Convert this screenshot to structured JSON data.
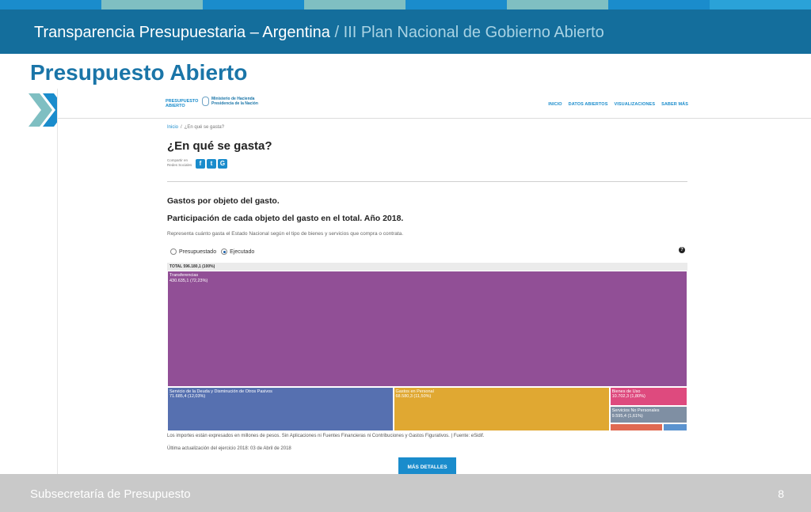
{
  "colors": {
    "stripe": [
      "#1a8ccc",
      "#7fbfc2",
      "#1a8ccc",
      "#7fbfc2",
      "#1a8ccc",
      "#7fbfc2",
      "#1a8ccc",
      "#2aa2d8"
    ],
    "topbar": "#146e9c",
    "accent": "#1a75a8"
  },
  "slide": {
    "header_main": "Transparencia Presupuestaria – Argentina",
    "header_sep": " / ",
    "header_sub": "III Plan Nacional de Gobierno Abierto",
    "title": "Presupuesto Abierto",
    "footer": "Subsecretaría de Presupuesto",
    "page_number": "8"
  },
  "site": {
    "logo_line1": "PRESUPUESTO",
    "logo_line2": "ABIERTO",
    "ministry_line1": "Ministerio de Hacienda",
    "ministry_line2": "Presidencia de la Nación",
    "nav": [
      "INICIO",
      "DATOS ABIERTOS",
      "VISUALIZACIONES",
      "SABER MÁS"
    ],
    "breadcrumb_home": "Inicio",
    "breadcrumb_sep": "/",
    "breadcrumb_current": "¿En qué se gasta?",
    "page_title": "¿En qué se gasta?",
    "share_line1": "Compartir en",
    "share_line2": "Redes Sociales",
    "share_icons": [
      "facebook-icon",
      "twitter-icon",
      "google-plus-icon"
    ],
    "section_title": "Gastos por objeto del gasto.",
    "chart_title": "Participación de cada objeto del gasto en el total. Año 2018.",
    "chart_description": "Representa cuánto gasta el Estado Nacional según el tipo de bienes y servicios que compra o contrata.",
    "radio_options": [
      {
        "label": "Presupuestado",
        "selected": false
      },
      {
        "label": "Ejecutado",
        "selected": true
      }
    ],
    "note": "Los importes están expresados en millones de pesos. Sin Aplicaciones ni Fuentes Financieras ni Contribuciones y Gastos Figurativos. | Fuente: eSidif.",
    "updated": "Última actualización del ejercicio 2018: 03 de Abril de 2018",
    "details_button": "MÁS DETALLES"
  },
  "chart_data": {
    "type": "treemap",
    "total_label": "TOTAL 596.180,1 (100%)",
    "total": 596180.1,
    "items": [
      {
        "name": "Transferencias",
        "value_label": "430.635,1 (72,23%)",
        "value": 430635.1,
        "color": "#914f96"
      },
      {
        "name": "Servicio de la Deuda y Disminución de Otros Pasivos",
        "value_label": "71.685,4 (12,03%)",
        "value": 71685.4,
        "color": "#5670b0"
      },
      {
        "name": "Gastos en Personal",
        "value_label": "68.580,3 (11,50%)",
        "value": 68580.3,
        "color": "#e0a832"
      },
      {
        "name": "Bienes de Uso",
        "value_label": "10.702,3 (1,80%)",
        "value": 10702.3,
        "color": "#de4a7e"
      },
      {
        "name": "Servicios No Personales",
        "value_label": "9.595,4 (1,61%)",
        "value": 9595.4,
        "color": "#7f8fa3"
      },
      {
        "name": "",
        "value_label": "",
        "value": 3000,
        "color": "#e06a52"
      },
      {
        "name": "",
        "value_label": "",
        "value": 1400,
        "color": "#5b93cf"
      }
    ]
  }
}
